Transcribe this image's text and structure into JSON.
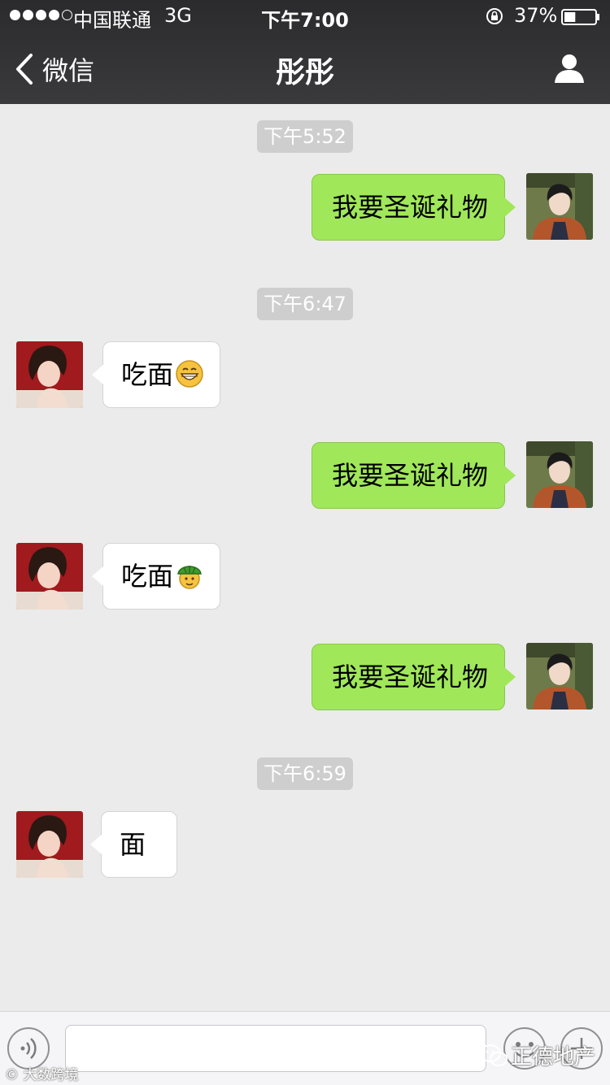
{
  "status_bar": {
    "carrier": "中国联通",
    "network": "3G",
    "time": "下午7:00",
    "battery": "37%",
    "battery_level": 0.37
  },
  "nav": {
    "back_label": "微信",
    "title": "彤彤"
  },
  "timestamps": [
    "下午5:52",
    "下午6:47",
    "下午6:59"
  ],
  "messages": [
    {
      "sender": "me",
      "text": "我要圣诞礼物"
    },
    {
      "sender": "other",
      "text": "吃面",
      "emoji": "grinning-emoji"
    },
    {
      "sender": "me",
      "text": "我要圣诞礼物"
    },
    {
      "sender": "other",
      "text": "吃面",
      "emoji": "turtle-emoji"
    },
    {
      "sender": "me",
      "text": "我要圣诞礼物"
    },
    {
      "sender": "other",
      "text": "面"
    }
  ],
  "input": {
    "value": "",
    "placeholder": ""
  },
  "watermarks": {
    "right": "正德地产",
    "left": "大数跨境"
  },
  "colors": {
    "nav_bg": "#2e2e30",
    "chat_bg": "#ebebeb",
    "my_bubble": "#a0e75a",
    "other_bubble": "#ffffff",
    "timestamp_bg": "#cecece"
  },
  "icons": [
    "signal-dots",
    "lock-rotation-icon",
    "battery-icon",
    "back-chevron-icon",
    "profile-icon",
    "voice-icon",
    "emoji-icon",
    "plus-icon",
    "wechat-logo-icon"
  ]
}
